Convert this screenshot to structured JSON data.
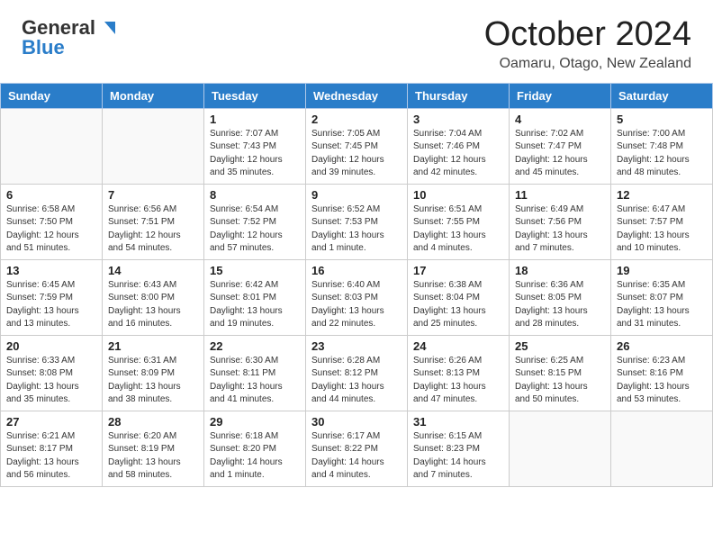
{
  "header": {
    "logo_general": "General",
    "logo_blue": "Blue",
    "month": "October 2024",
    "location": "Oamaru, Otago, New Zealand"
  },
  "weekdays": [
    "Sunday",
    "Monday",
    "Tuesday",
    "Wednesday",
    "Thursday",
    "Friday",
    "Saturday"
  ],
  "weeks": [
    [
      {
        "day": "",
        "detail": ""
      },
      {
        "day": "",
        "detail": ""
      },
      {
        "day": "1",
        "detail": "Sunrise: 7:07 AM\nSunset: 7:43 PM\nDaylight: 12 hours\nand 35 minutes."
      },
      {
        "day": "2",
        "detail": "Sunrise: 7:05 AM\nSunset: 7:45 PM\nDaylight: 12 hours\nand 39 minutes."
      },
      {
        "day": "3",
        "detail": "Sunrise: 7:04 AM\nSunset: 7:46 PM\nDaylight: 12 hours\nand 42 minutes."
      },
      {
        "day": "4",
        "detail": "Sunrise: 7:02 AM\nSunset: 7:47 PM\nDaylight: 12 hours\nand 45 minutes."
      },
      {
        "day": "5",
        "detail": "Sunrise: 7:00 AM\nSunset: 7:48 PM\nDaylight: 12 hours\nand 48 minutes."
      }
    ],
    [
      {
        "day": "6",
        "detail": "Sunrise: 6:58 AM\nSunset: 7:50 PM\nDaylight: 12 hours\nand 51 minutes."
      },
      {
        "day": "7",
        "detail": "Sunrise: 6:56 AM\nSunset: 7:51 PM\nDaylight: 12 hours\nand 54 minutes."
      },
      {
        "day": "8",
        "detail": "Sunrise: 6:54 AM\nSunset: 7:52 PM\nDaylight: 12 hours\nand 57 minutes."
      },
      {
        "day": "9",
        "detail": "Sunrise: 6:52 AM\nSunset: 7:53 PM\nDaylight: 13 hours\nand 1 minute."
      },
      {
        "day": "10",
        "detail": "Sunrise: 6:51 AM\nSunset: 7:55 PM\nDaylight: 13 hours\nand 4 minutes."
      },
      {
        "day": "11",
        "detail": "Sunrise: 6:49 AM\nSunset: 7:56 PM\nDaylight: 13 hours\nand 7 minutes."
      },
      {
        "day": "12",
        "detail": "Sunrise: 6:47 AM\nSunset: 7:57 PM\nDaylight: 13 hours\nand 10 minutes."
      }
    ],
    [
      {
        "day": "13",
        "detail": "Sunrise: 6:45 AM\nSunset: 7:59 PM\nDaylight: 13 hours\nand 13 minutes."
      },
      {
        "day": "14",
        "detail": "Sunrise: 6:43 AM\nSunset: 8:00 PM\nDaylight: 13 hours\nand 16 minutes."
      },
      {
        "day": "15",
        "detail": "Sunrise: 6:42 AM\nSunset: 8:01 PM\nDaylight: 13 hours\nand 19 minutes."
      },
      {
        "day": "16",
        "detail": "Sunrise: 6:40 AM\nSunset: 8:03 PM\nDaylight: 13 hours\nand 22 minutes."
      },
      {
        "day": "17",
        "detail": "Sunrise: 6:38 AM\nSunset: 8:04 PM\nDaylight: 13 hours\nand 25 minutes."
      },
      {
        "day": "18",
        "detail": "Sunrise: 6:36 AM\nSunset: 8:05 PM\nDaylight: 13 hours\nand 28 minutes."
      },
      {
        "day": "19",
        "detail": "Sunrise: 6:35 AM\nSunset: 8:07 PM\nDaylight: 13 hours\nand 31 minutes."
      }
    ],
    [
      {
        "day": "20",
        "detail": "Sunrise: 6:33 AM\nSunset: 8:08 PM\nDaylight: 13 hours\nand 35 minutes."
      },
      {
        "day": "21",
        "detail": "Sunrise: 6:31 AM\nSunset: 8:09 PM\nDaylight: 13 hours\nand 38 minutes."
      },
      {
        "day": "22",
        "detail": "Sunrise: 6:30 AM\nSunset: 8:11 PM\nDaylight: 13 hours\nand 41 minutes."
      },
      {
        "day": "23",
        "detail": "Sunrise: 6:28 AM\nSunset: 8:12 PM\nDaylight: 13 hours\nand 44 minutes."
      },
      {
        "day": "24",
        "detail": "Sunrise: 6:26 AM\nSunset: 8:13 PM\nDaylight: 13 hours\nand 47 minutes."
      },
      {
        "day": "25",
        "detail": "Sunrise: 6:25 AM\nSunset: 8:15 PM\nDaylight: 13 hours\nand 50 minutes."
      },
      {
        "day": "26",
        "detail": "Sunrise: 6:23 AM\nSunset: 8:16 PM\nDaylight: 13 hours\nand 53 minutes."
      }
    ],
    [
      {
        "day": "27",
        "detail": "Sunrise: 6:21 AM\nSunset: 8:17 PM\nDaylight: 13 hours\nand 56 minutes."
      },
      {
        "day": "28",
        "detail": "Sunrise: 6:20 AM\nSunset: 8:19 PM\nDaylight: 13 hours\nand 58 minutes."
      },
      {
        "day": "29",
        "detail": "Sunrise: 6:18 AM\nSunset: 8:20 PM\nDaylight: 14 hours\nand 1 minute."
      },
      {
        "day": "30",
        "detail": "Sunrise: 6:17 AM\nSunset: 8:22 PM\nDaylight: 14 hours\nand 4 minutes."
      },
      {
        "day": "31",
        "detail": "Sunrise: 6:15 AM\nSunset: 8:23 PM\nDaylight: 14 hours\nand 7 minutes."
      },
      {
        "day": "",
        "detail": ""
      },
      {
        "day": "",
        "detail": ""
      }
    ]
  ]
}
